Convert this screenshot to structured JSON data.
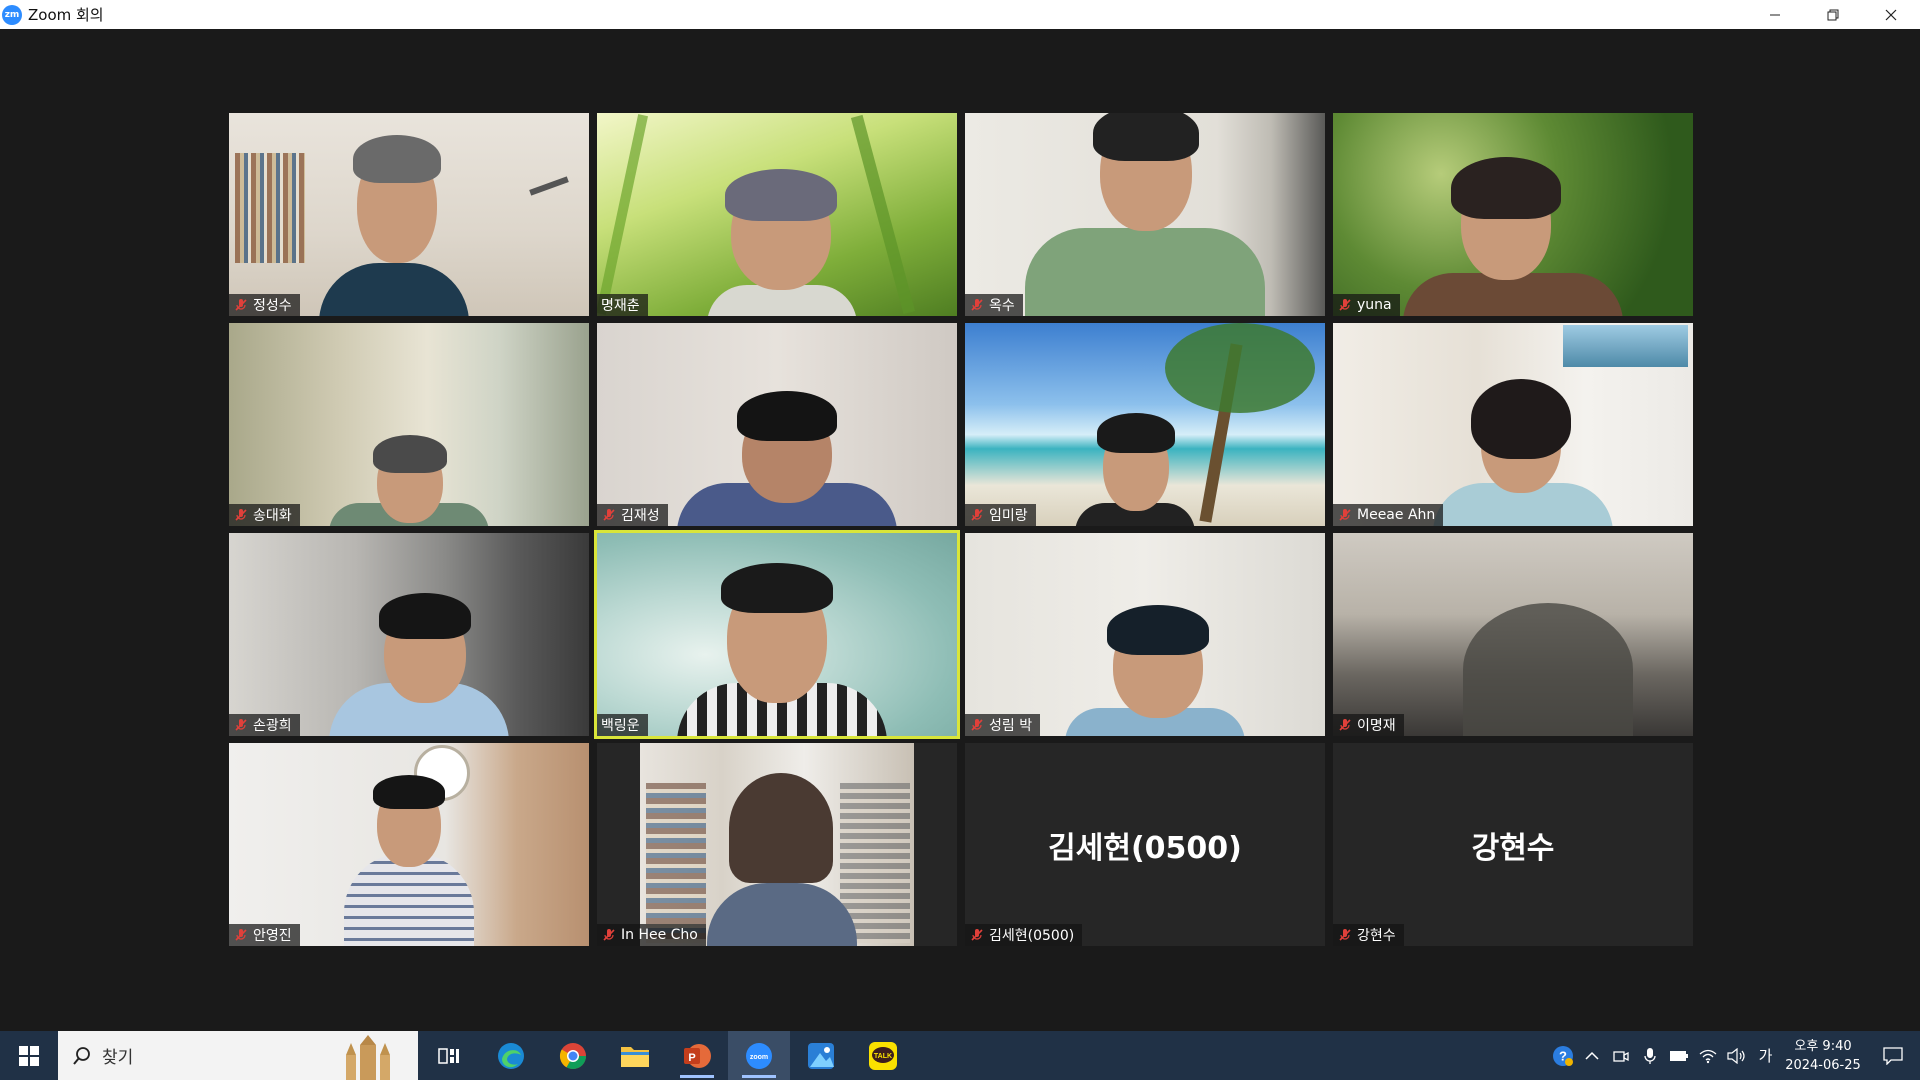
{
  "window": {
    "title": "Zoom 회의",
    "app_icon": "zm"
  },
  "colors": {
    "meeting_bg": "#1a1a1a",
    "active_speaker": "#d9e53a",
    "mute": "#e0403a",
    "taskbar": "#203146"
  },
  "participants": [
    {
      "name": "정성수",
      "muted": true
    },
    {
      "name": "명재춘",
      "muted": false
    },
    {
      "name": "옥수",
      "muted": true
    },
    {
      "name": "yuna",
      "muted": true
    },
    {
      "name": "송대화",
      "muted": true
    },
    {
      "name": "김재성",
      "muted": true
    },
    {
      "name": "임미랑",
      "muted": true
    },
    {
      "name": "Meeae Ahn",
      "muted": true
    },
    {
      "name": "손광희",
      "muted": true
    },
    {
      "name": "백링운",
      "muted": false,
      "active_speaker": true
    },
    {
      "name": "성림 박",
      "muted": true
    },
    {
      "name": "이명재",
      "muted": true
    },
    {
      "name": "안영진",
      "muted": true
    },
    {
      "name": "In Hee Cho",
      "muted": true
    },
    {
      "name": "김세현(0500)",
      "muted": true,
      "video_off": true,
      "display_name": "김세현(0500)"
    },
    {
      "name": "강현수",
      "muted": true,
      "video_off": true,
      "display_name": "강현수"
    }
  ],
  "taskbar": {
    "search_placeholder": "찾기",
    "apps": [
      "task-view",
      "edge",
      "chrome",
      "file-explorer",
      "powerpoint",
      "zoom",
      "photos",
      "kakaotalk"
    ],
    "input_lang": "가",
    "clock_time": "오후 9:40",
    "clock_date": "2024-06-25"
  }
}
